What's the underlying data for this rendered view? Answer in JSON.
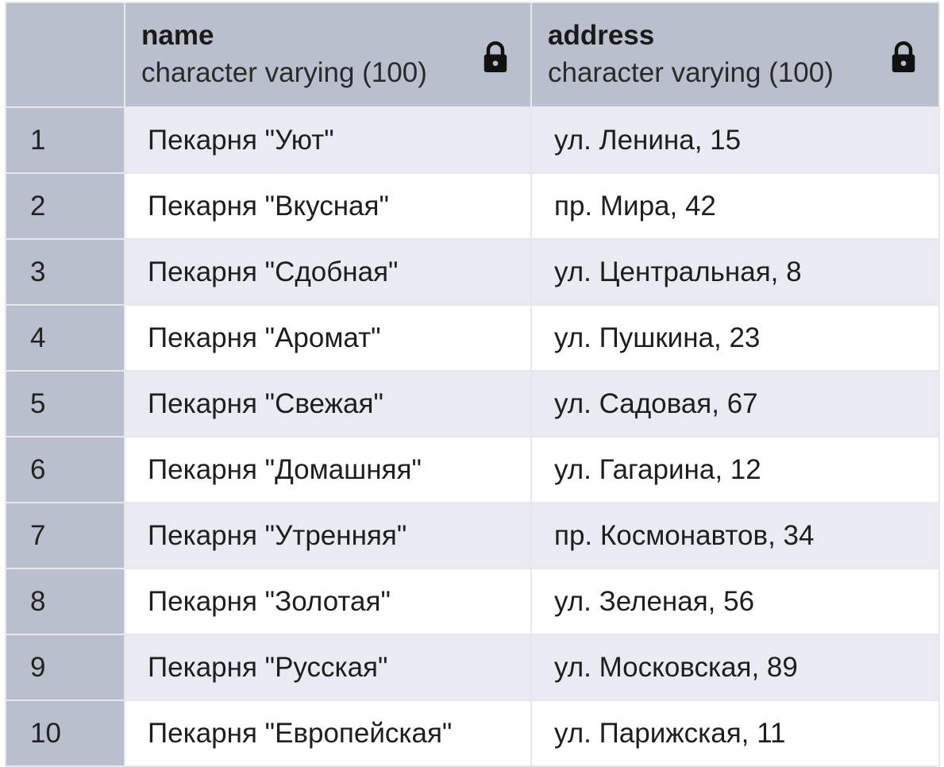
{
  "columns": [
    {
      "name": "name",
      "type": "character varying (100)",
      "icon": "lock-icon"
    },
    {
      "name": "address",
      "type": "character varying (100)",
      "icon": "lock-icon"
    }
  ],
  "rows": [
    {
      "index": "1",
      "name": "Пекарня \"Уют\"",
      "address": "ул. Ленина, 15"
    },
    {
      "index": "2",
      "name": "Пекарня \"Вкусная\"",
      "address": "пр. Мира, 42"
    },
    {
      "index": "3",
      "name": "Пекарня \"Сдобная\"",
      "address": "ул. Центральная, 8"
    },
    {
      "index": "4",
      "name": "Пекарня \"Аромат\"",
      "address": "ул. Пушкина, 23"
    },
    {
      "index": "5",
      "name": "Пекарня \"Свежая\"",
      "address": "ул. Садовая, 67"
    },
    {
      "index": "6",
      "name": "Пекарня \"Домашняя\"",
      "address": "ул. Гагарина, 12"
    },
    {
      "index": "7",
      "name": "Пекарня \"Утренняя\"",
      "address": "пр. Космонавтов, 34"
    },
    {
      "index": "8",
      "name": "Пекарня \"Золотая\"",
      "address": "ул. Зеленая, 56"
    },
    {
      "index": "9",
      "name": "Пекарня \"Русская\"",
      "address": "ул. Московская, 89"
    },
    {
      "index": "10",
      "name": "Пекарня \"Европейская\"",
      "address": "ул. Парижская, 11"
    }
  ],
  "colors": {
    "header_bg": "#b9bfcc",
    "row_alt_bg": "#e8ebf1",
    "grid_line": "#e6e8ec"
  }
}
